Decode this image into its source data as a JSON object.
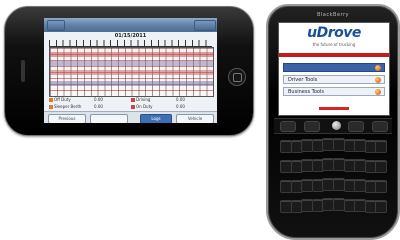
{
  "iphone": {
    "nav": {
      "back_label": "",
      "title": "",
      "action_label": ""
    },
    "date_header": "01/15/2011",
    "totals": [
      {
        "label": "Off Duty",
        "value": "0.00",
        "color": "#e07a22"
      },
      {
        "label": "Sleeper Berth",
        "value": "0.00",
        "color": "#e07a22"
      },
      {
        "label": "Driving",
        "value": "0.00",
        "color": "#c04a4a"
      },
      {
        "label": "On Duty",
        "value": "0.00",
        "color": "#c04a4a"
      }
    ],
    "toolbar": {
      "previous_label": "Previous",
      "next_label": "",
      "log_label": "Logs",
      "vehicle_label": "Vehicle"
    }
  },
  "blackberry": {
    "brand": "BlackBerry",
    "logo": "uDrove",
    "tagline": "the future of trucking",
    "menu": [
      {
        "label": "",
        "selected": true
      },
      {
        "label": "Driver Tools",
        "selected": false
      },
      {
        "label": "Business Tools",
        "selected": false
      }
    ]
  }
}
